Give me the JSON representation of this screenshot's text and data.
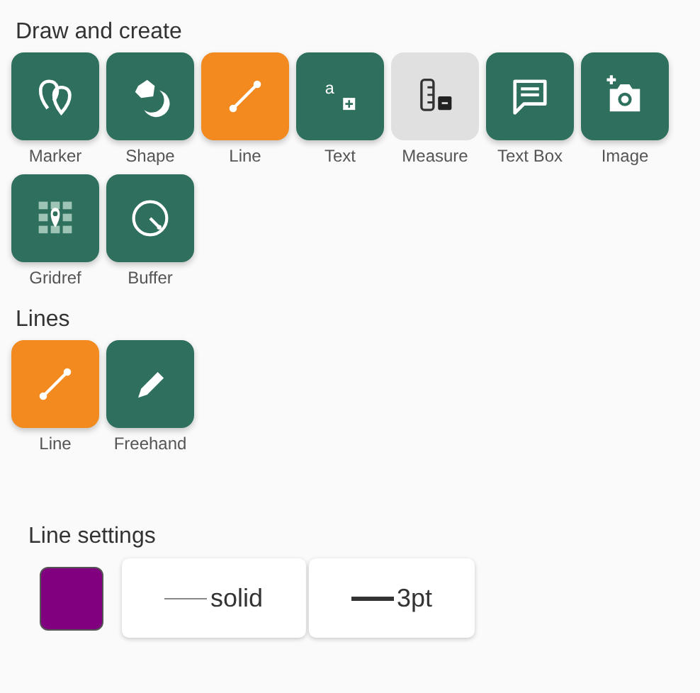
{
  "sections": [
    {
      "heading": "Draw and create",
      "tools": [
        {
          "kind": "marker",
          "label": "Marker",
          "selected": false,
          "disabled": false
        },
        {
          "kind": "shape",
          "label": "Shape",
          "selected": false,
          "disabled": false
        },
        {
          "kind": "line",
          "label": "Line",
          "selected": true,
          "disabled": false
        },
        {
          "kind": "text",
          "label": "Text",
          "glyph": "a",
          "selected": false,
          "disabled": false
        },
        {
          "kind": "measure",
          "label": "Measure",
          "selected": false,
          "disabled": true
        },
        {
          "kind": "textbox",
          "label": "Text Box",
          "selected": false,
          "disabled": false
        },
        {
          "kind": "image",
          "label": "Image",
          "selected": false,
          "disabled": false
        },
        {
          "kind": "gridref",
          "label": "Gridref",
          "selected": false,
          "disabled": false
        },
        {
          "kind": "buffer",
          "label": "Buffer",
          "selected": false,
          "disabled": false
        }
      ]
    },
    {
      "heading": "Lines",
      "tools": [
        {
          "kind": "line",
          "label": "Line",
          "selected": true,
          "disabled": false
        },
        {
          "kind": "freehand",
          "label": "Freehand",
          "selected": false,
          "disabled": false
        }
      ]
    }
  ],
  "line_settings": {
    "heading": "Line settings",
    "color": "#800080",
    "options": [
      {
        "kind": "style",
        "label": "solid"
      },
      {
        "kind": "width",
        "label": "3pt"
      }
    ]
  }
}
